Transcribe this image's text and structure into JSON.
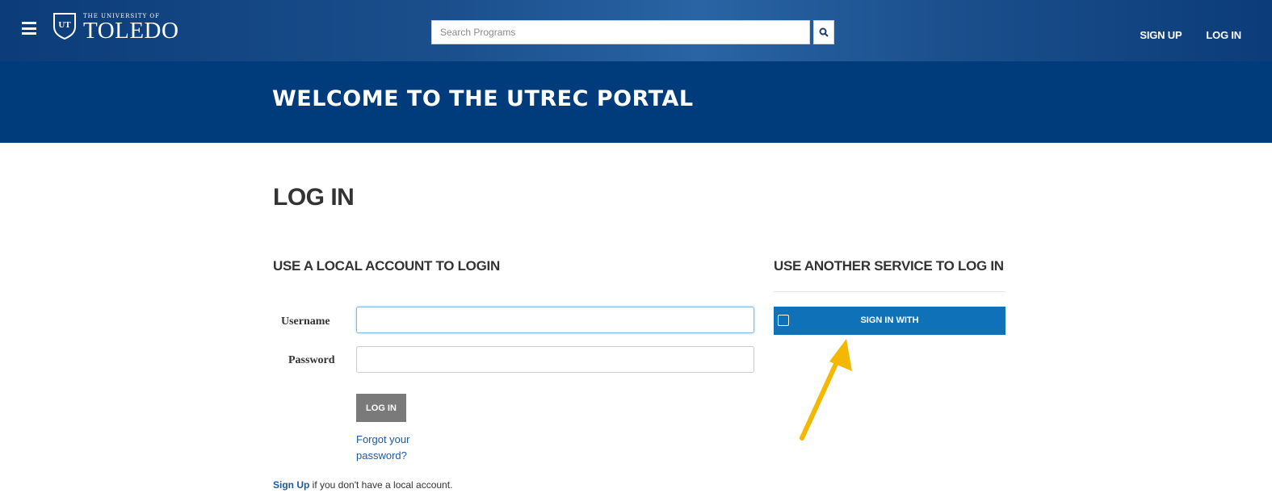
{
  "header": {
    "logo_small": "THE UNIVERSITY OF",
    "logo_big": "TOLEDO",
    "search_placeholder": "Search Programs",
    "sign_up": "SIGN UP",
    "log_in": "LOG IN"
  },
  "banner": {
    "title": "WELCOME TO THE UTREC PORTAL"
  },
  "main": {
    "title": "LOG IN",
    "local_heading": "USE A LOCAL ACCOUNT TO LOGIN",
    "username_label": "Username",
    "username_value": "",
    "password_label": "Password",
    "password_value": "",
    "login_button": "LOG IN",
    "forgot_link": "Forgot your password?",
    "signup_link": "Sign Up",
    "signup_text": " if you don't have a local account.",
    "other_heading": "USE ANOTHER SERVICE TO LOG IN",
    "sso_button": "SIGN IN WITH"
  },
  "colors": {
    "header_blue": "#0c3c7a",
    "banner_blue": "#003b7c",
    "sso_blue": "#0f72b8",
    "annotation_arrow": "#f5b800"
  },
  "icons": [
    "menu-icon",
    "university-shield-icon",
    "search-icon",
    "sso-icon",
    "annotation-arrow"
  ]
}
